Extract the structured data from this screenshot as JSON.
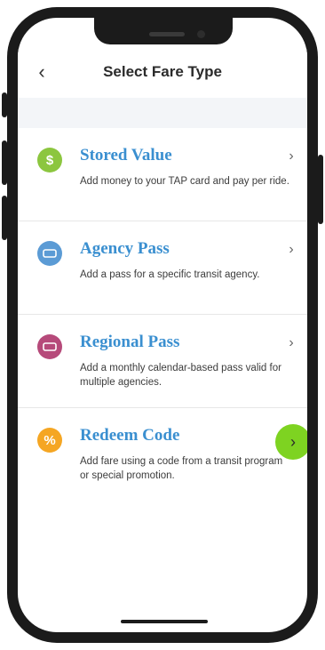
{
  "header": {
    "title": "Select Fare Type",
    "back_icon": "chevron-left-icon"
  },
  "fare_types": [
    {
      "icon": "dollar-icon",
      "icon_glyph": "$",
      "icon_color": "#8cc63f",
      "title": "Stored Value",
      "description": "Add money to your TAP card and pay per ride."
    },
    {
      "icon": "ticket-icon",
      "icon_glyph": "▭",
      "icon_color": "#5b9bd5",
      "title": "Agency Pass",
      "description": "Add a pass for a specific transit agency."
    },
    {
      "icon": "ticket-icon",
      "icon_glyph": "▭",
      "icon_color": "#b64a7a",
      "title": "Regional Pass",
      "description": "Add a monthly calendar-based pass valid for multiple agencies."
    },
    {
      "icon": "percent-icon",
      "icon_glyph": "%",
      "icon_color": "#f5a623",
      "title": "Redeem Code",
      "description": "Add fare using a code from a transit program or special promotion."
    }
  ],
  "colors": {
    "accent_blue": "#3a8fd0",
    "highlight_green": "#7ed321"
  }
}
